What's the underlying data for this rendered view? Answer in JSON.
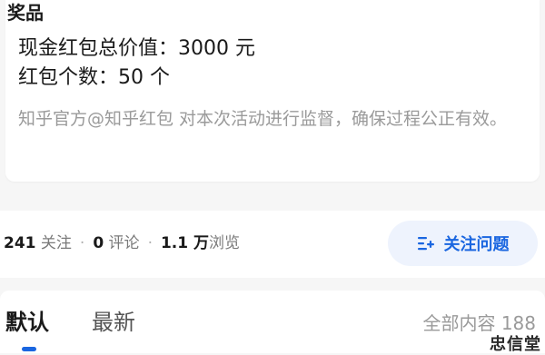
{
  "prize": {
    "title": "奖品",
    "total_value": "现金红包总价值：3000 元",
    "count": "红包个数：50 个",
    "note": "知乎官方@知乎红包 对本次活动进行监督，确保过程公正有效。"
  },
  "stats": {
    "followers_count": "241",
    "followers_label": " 关注",
    "comments_count": "0",
    "comments_label": " 评论",
    "views_count": "1.1 万",
    "views_label": "浏览",
    "separator": "·"
  },
  "follow_button": {
    "label": "关注问题",
    "icon": "follow-question-icon"
  },
  "tabs": [
    {
      "label": "默认",
      "active": true
    },
    {
      "label": "最新",
      "active": false
    }
  ],
  "content_total": "全部内容 188",
  "watermark": "忠信堂",
  "colors": {
    "accent": "#1a66e0",
    "button_bg": "#eef3fd",
    "muted_text": "#9a9a9a",
    "page_bg": "#f6f6f6"
  }
}
